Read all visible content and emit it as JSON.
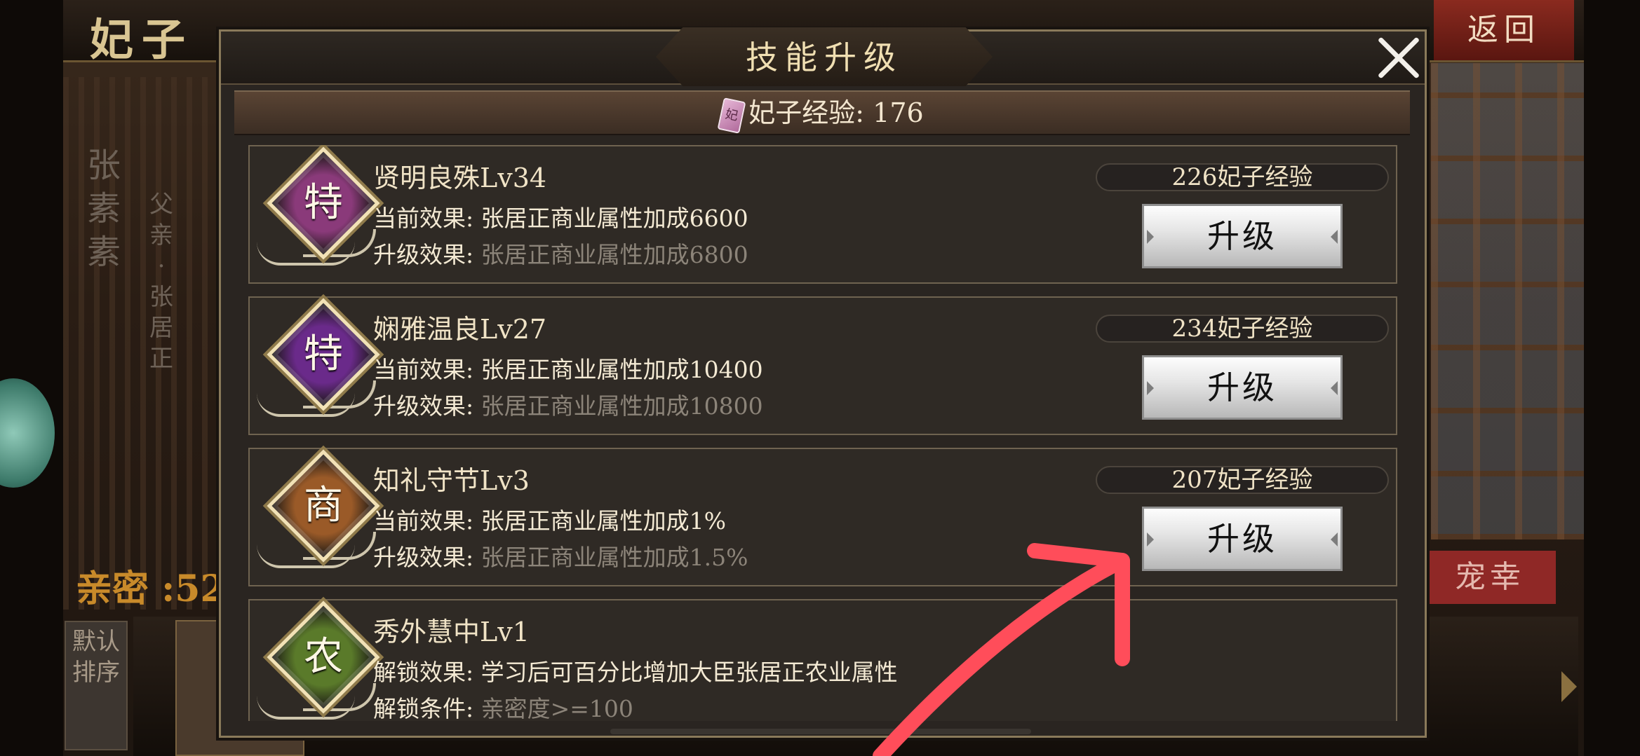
{
  "background": {
    "screen_title": "妃子",
    "return_label": "返回",
    "consort_name": "张素素",
    "father_text": "父亲·张居正",
    "intimacy_text": "亲密 :52",
    "favor_label": "宠幸",
    "sort_label": "默认排序"
  },
  "dialog": {
    "title": "技能升级",
    "exp_icon_glyph": "妃",
    "exp_label": "妃子经验: 176",
    "skills": [
      {
        "glyph": "特",
        "color": "#8a3a7a",
        "name": "贤明良殊Lv34",
        "line1_label": "当前效果:",
        "line1_value": "张居正商业属性加成6600",
        "line2_label": "升级效果:",
        "line2_value": "张居正商业属性加成6800",
        "cost": "226妃子经验",
        "button": "升级"
      },
      {
        "glyph": "特",
        "color": "#6a2a8a",
        "name": "娴雅温良Lv27",
        "line1_label": "当前效果:",
        "line1_value": "张居正商业属性加成10400",
        "line2_label": "升级效果:",
        "line2_value": "张居正商业属性加成10800",
        "cost": "234妃子经验",
        "button": "升级"
      },
      {
        "glyph": "商",
        "color": "#9a5a28",
        "name": "知礼守节Lv3",
        "line1_label": "当前效果:",
        "line1_value": "张居正商业属性加成1%",
        "line2_label": "升级效果:",
        "line2_value": "张居正商业属性加成1.5%",
        "cost": "207妃子经验",
        "button": "升级"
      },
      {
        "glyph": "农",
        "color": "#5a7a2a",
        "name": "秀外慧中Lv1",
        "line1_label": "解锁效果:",
        "line1_value": "学习后可百分比增加大臣张居正农业属性",
        "line2_label": "解锁条件:",
        "line2_value": "亲密度>=100"
      }
    ]
  },
  "colors": {
    "annotation_arrow": "#ff4d5a",
    "text_gold": "#f0e3c6",
    "text_dim": "#8c8479"
  }
}
